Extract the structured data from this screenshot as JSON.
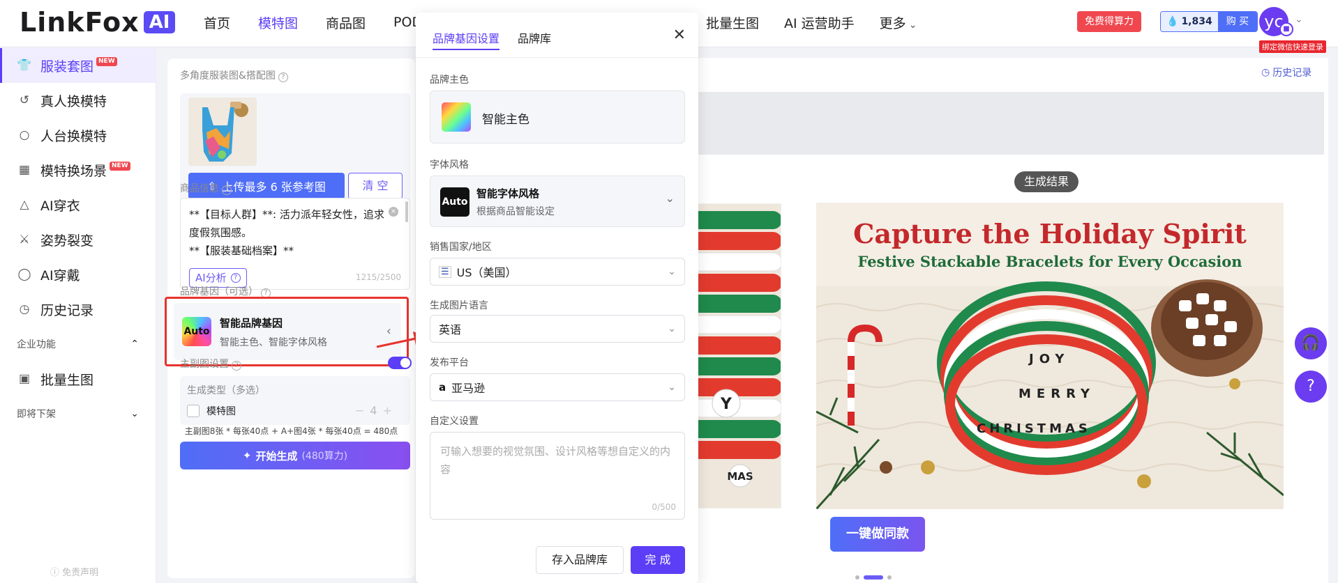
{
  "brand": {
    "name": "LinkFox",
    "ai_tag": "AI"
  },
  "nav": {
    "items": [
      "首页",
      "模特图",
      "商品图",
      "POD"
    ],
    "items_right": [
      "批量生图",
      "AI 运营助手",
      "更多"
    ],
    "active": "模特图"
  },
  "header": {
    "free_credits": "免费得算力",
    "credits": "1,834",
    "buy": "购 买",
    "avatar": "yc",
    "wechat_bind": "绑定微信快速登录"
  },
  "sidebar": {
    "items": [
      {
        "label": "服装套图",
        "icon": "shirt-icon",
        "badge": "NEW",
        "active": true
      },
      {
        "label": "真人换模特",
        "icon": "swap-person-icon"
      },
      {
        "label": "人台换模特",
        "icon": "mannequin-icon"
      },
      {
        "label": "模特换场景",
        "icon": "scene-icon",
        "badge": "NEW"
      },
      {
        "label": "AI穿衣",
        "icon": "hanger-icon"
      },
      {
        "label": "姿势裂变",
        "icon": "pose-icon"
      },
      {
        "label": "AI穿戴",
        "icon": "accessory-icon"
      },
      {
        "label": "历史记录",
        "icon": "history-icon"
      }
    ],
    "group_enterprise": "企业功能",
    "batch": "批量生图",
    "group_offline": "即将下架",
    "disclaimer": "免责声明"
  },
  "panel": {
    "ref_label": "多角度服装图&搭配图",
    "upload_label": "上传最多 6 张参考图",
    "clear_label": "清 空",
    "info_label": "商品信息",
    "info_text": "**【目标人群】**: 活力派年轻女性，追求度假氛围感。\n**【服装基础档案】**",
    "ai_analyze": "AI分析",
    "info_count": "1215/2500",
    "brand_label": "品牌基因（可选）",
    "brand_title": "智能品牌基因",
    "brand_sub": "智能主色、智能字体风格",
    "brand_auto": "Auto",
    "main_setting_label": "主副图设置",
    "gen_type_label": "生成类型（多选）",
    "gen_option": "模特图",
    "gen_count": "4",
    "formula": "主副图8张 * 每张40点 + A+图4张 * 每张40点 = 480点",
    "start_label": "开始生成",
    "start_cost": "(480算力)"
  },
  "modal": {
    "tabs": [
      "品牌基因设置",
      "品牌库"
    ],
    "main_color_label": "品牌主色",
    "main_color_value": "智能主色",
    "font_label": "字体风格",
    "font_value": "智能字体风格",
    "font_sub": "根据商品智能设定",
    "font_tile": "Auto",
    "country_label": "销售国家/地区",
    "country_value": "US（美国）",
    "language_label": "生成图片语言",
    "language_value": "英语",
    "platform_label": "发布平台",
    "platform_value": "亚马逊",
    "custom_label": "自定义设置",
    "custom_placeholder": "可输入想要的视觉氛围、设计风格等想自定义的内容",
    "custom_count": "0/500",
    "save_lib": "存入品牌库",
    "done": "完 成"
  },
  "main": {
    "history_link": "历史记录",
    "result_tag": "生成结果",
    "banner_title": "Capture the Holiday Spirit",
    "banner_sub": "Festive Stackable Bracelets for Every Occasion",
    "bead_joy": "JOY",
    "bead_merry": "MERRY",
    "bead_christmas": "CHRISTMAS",
    "bead_side": "Y",
    "bead_side2": "MAS",
    "same_style": "一键做同款"
  }
}
